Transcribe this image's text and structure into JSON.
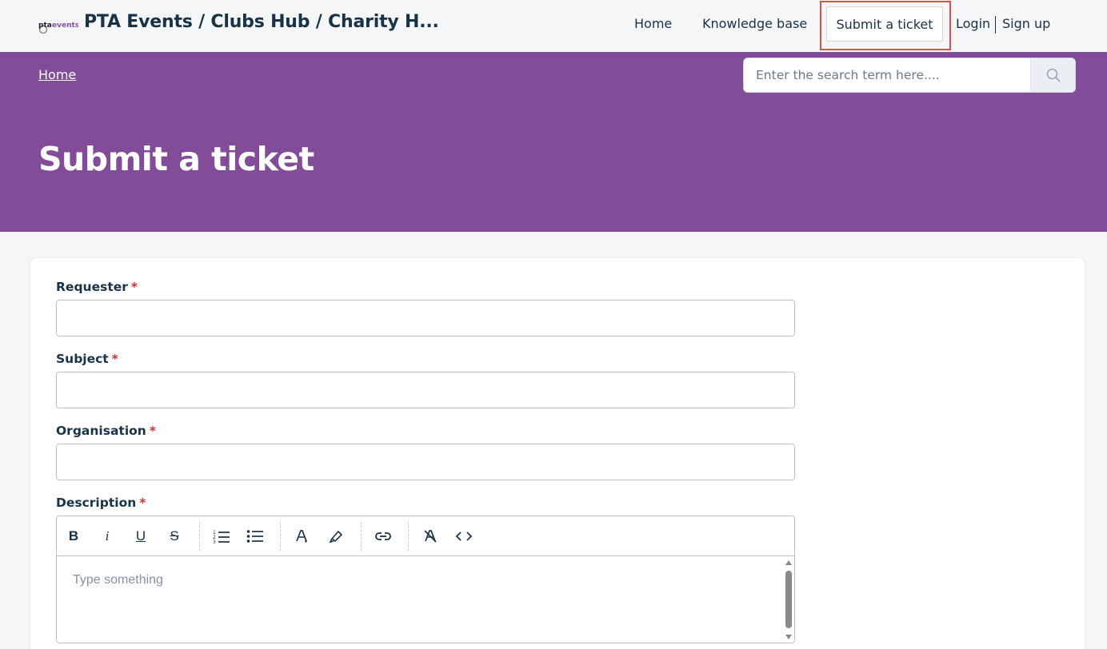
{
  "header": {
    "logo_text_a": "pta",
    "logo_text_b": "events",
    "brand_title": "PTA Events / Clubs Hub / Charity H...",
    "nav": {
      "home": "Home",
      "knowledge_base": "Knowledge base",
      "submit_ticket": "Submit a ticket",
      "login": "Login",
      "signup": "Sign up"
    }
  },
  "banner": {
    "breadcrumb": "Home",
    "search_placeholder": "Enter the search term here....",
    "page_title": "Submit a ticket"
  },
  "form": {
    "requester_label": "Requester",
    "subject_label": "Subject",
    "organisation_label": "Organisation",
    "description_label": "Description",
    "required_mark": "*",
    "description_placeholder": "Type something",
    "toolbar": {
      "bold": "B",
      "italic": "i",
      "underline": "U",
      "strike": "S"
    }
  },
  "icons": [
    "logo",
    "search-icon",
    "bold-icon",
    "italic-icon",
    "underline-icon",
    "strikethrough-icon",
    "ordered-list-icon",
    "bullet-list-icon",
    "font-color-icon",
    "highlight-icon",
    "link-icon",
    "clear-format-icon",
    "code-icon"
  ],
  "colors": {
    "banner": "#824c98",
    "text": "#183247",
    "required": "#d72d30",
    "highlight_outline": "#e34c4c"
  }
}
